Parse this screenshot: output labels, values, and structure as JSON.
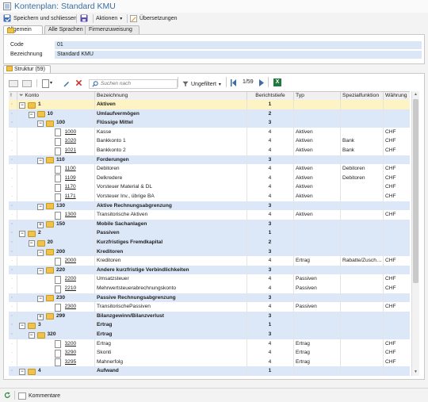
{
  "window": {
    "title": "Kontenplan: Standard KMU"
  },
  "toolbar": {
    "save_close_label": "Speichern und schliessen",
    "actions_label": "Aktionen",
    "translations_label": "Übersetzungen"
  },
  "tabs": [
    "Allgemein",
    "Alle Sprachen",
    "Firmenzuweisung"
  ],
  "fields": {
    "code_label": "Code",
    "code_value": "01",
    "name_label": "Bezeichnung",
    "name_value": "Standard KMU"
  },
  "structure_tab": "Struktur (59)",
  "gridbar": {
    "search_placeholder": "Suchen nach",
    "filter_label": "Ungefiltert",
    "page": "1/59"
  },
  "columns": [
    "!",
    "Konto",
    "Bezeichnung",
    "Berichtstiefe",
    "Typ",
    "Spezialfunktion",
    "Währung"
  ],
  "rows": [
    {
      "level": 0,
      "kind": "grp",
      "exp": "-",
      "konto": "1",
      "name": "Aktiven",
      "tiefe": "1",
      "typ": "",
      "spez": "",
      "cur": "",
      "sel": true
    },
    {
      "level": 1,
      "kind": "grp",
      "exp": "-",
      "konto": "10",
      "name": "Umlaufvermögen",
      "tiefe": "2",
      "typ": "",
      "spez": "",
      "cur": ""
    },
    {
      "level": 2,
      "kind": "grp",
      "exp": "-",
      "konto": "100",
      "name": "Flüssige Mittel",
      "tiefe": "3",
      "typ": "",
      "spez": "",
      "cur": ""
    },
    {
      "level": 3,
      "kind": "leaf",
      "konto": "1000",
      "name": "Kasse",
      "tiefe": "4",
      "typ": "Aktiven",
      "spez": "",
      "cur": "CHF"
    },
    {
      "level": 3,
      "kind": "leaf",
      "konto": "1020",
      "name": "Bankkonto 1",
      "tiefe": "4",
      "typ": "Aktiven",
      "spez": "Bank",
      "cur": "CHF"
    },
    {
      "level": 3,
      "kind": "leaf",
      "konto": "1021",
      "name": "Bankkonto 2",
      "tiefe": "4",
      "typ": "Aktiven",
      "spez": "Bank",
      "cur": "CHF"
    },
    {
      "level": 2,
      "kind": "grp",
      "exp": "-",
      "konto": "110",
      "name": "Forderungen",
      "tiefe": "3",
      "typ": "",
      "spez": "",
      "cur": ""
    },
    {
      "level": 3,
      "kind": "leaf",
      "konto": "1100",
      "name": "Debitoren",
      "tiefe": "4",
      "typ": "Aktiven",
      "spez": "Debitoren",
      "cur": "CHF"
    },
    {
      "level": 3,
      "kind": "leaf",
      "konto": "1109",
      "name": "Delkredere",
      "tiefe": "4",
      "typ": "Aktiven",
      "spez": "Debitoren",
      "cur": "CHF"
    },
    {
      "level": 3,
      "kind": "leaf",
      "konto": "1170",
      "name": "Vorsteuer Material & DL",
      "tiefe": "4",
      "typ": "Aktiven",
      "spez": "",
      "cur": "CHF"
    },
    {
      "level": 3,
      "kind": "leaf",
      "konto": "1171",
      "name": "Vorsteuer Inv., übrige BA",
      "tiefe": "4",
      "typ": "Aktiven",
      "spez": "",
      "cur": "CHF"
    },
    {
      "level": 2,
      "kind": "grp",
      "exp": "-",
      "konto": "130",
      "name": "Aktive Rechnungsabgrenzung",
      "tiefe": "3",
      "typ": "",
      "spez": "",
      "cur": ""
    },
    {
      "level": 3,
      "kind": "leaf",
      "konto": "1300",
      "name": "Transitorische Aktiven",
      "tiefe": "4",
      "typ": "Aktiven",
      "spez": "",
      "cur": "CHF"
    },
    {
      "level": 2,
      "kind": "grp",
      "exp": "+",
      "konto": "150",
      "name": "Mobile Sachanlagen",
      "tiefe": "3",
      "typ": "",
      "spez": "",
      "cur": ""
    },
    {
      "level": 0,
      "kind": "grp",
      "exp": "-",
      "konto": "2",
      "name": "Passiven",
      "tiefe": "1",
      "typ": "",
      "spez": "",
      "cur": ""
    },
    {
      "level": 1,
      "kind": "grp",
      "exp": "-",
      "konto": "20",
      "name": "Kurzfristiges Fremdkapital",
      "tiefe": "2",
      "typ": "",
      "spez": "",
      "cur": ""
    },
    {
      "level": 2,
      "kind": "grp",
      "exp": "-",
      "konto": "200",
      "name": "Kreditoren",
      "tiefe": "3",
      "typ": "",
      "spez": "",
      "cur": ""
    },
    {
      "level": 3,
      "kind": "leaf",
      "konto": "2000",
      "name": "Kreditoren",
      "tiefe": "4",
      "typ": "Ertrag",
      "spez": "Rabatte/Zusch…",
      "cur": "CHF"
    },
    {
      "level": 2,
      "kind": "grp",
      "exp": "-",
      "konto": "220",
      "name": "Andere kurzfristige Verbindlichkeiten",
      "tiefe": "3",
      "typ": "",
      "spez": "",
      "cur": ""
    },
    {
      "level": 3,
      "kind": "leaf",
      "konto": "2200",
      "name": "Umsatzsteuer",
      "tiefe": "4",
      "typ": "Passiven",
      "spez": "",
      "cur": "CHF"
    },
    {
      "level": 3,
      "kind": "leaf",
      "konto": "2210",
      "name": "Mehrwertsteuerabrechnungskonto",
      "tiefe": "4",
      "typ": "Passiven",
      "spez": "",
      "cur": "CHF"
    },
    {
      "level": 2,
      "kind": "grp",
      "exp": "-",
      "konto": "230",
      "name": "Passive Rechnungsabgrenzung",
      "tiefe": "3",
      "typ": "",
      "spez": "",
      "cur": ""
    },
    {
      "level": 3,
      "kind": "leaf",
      "konto": "2300",
      "name": "TransitorischePassiven",
      "tiefe": "4",
      "typ": "Passiven",
      "spez": "",
      "cur": "CHF"
    },
    {
      "level": 2,
      "kind": "grp",
      "exp": "+",
      "konto": "299",
      "name": "Bilanzgewinn/Bilanzverlust",
      "tiefe": "3",
      "typ": "",
      "spez": "",
      "cur": ""
    },
    {
      "level": 0,
      "kind": "grp",
      "exp": "-",
      "konto": "3",
      "name": "Ertrag",
      "tiefe": "1",
      "typ": "",
      "spez": "",
      "cur": ""
    },
    {
      "level": 1,
      "kind": "grp",
      "exp": "-",
      "konto": "320",
      "name": "Ertrag",
      "tiefe": "3",
      "typ": "",
      "spez": "",
      "cur": ""
    },
    {
      "level": 3,
      "kind": "leaf",
      "konto": "3200",
      "name": "Ertrag",
      "tiefe": "4",
      "typ": "Ertrag",
      "spez": "",
      "cur": "CHF"
    },
    {
      "level": 3,
      "kind": "leaf",
      "konto": "3290",
      "name": "Skonti",
      "tiefe": "4",
      "typ": "Ertrag",
      "spez": "",
      "cur": "CHF"
    },
    {
      "level": 3,
      "kind": "leaf",
      "konto": "3295",
      "name": "Mahnerfolg",
      "tiefe": "4",
      "typ": "Ertrag",
      "spez": "",
      "cur": "CHF"
    },
    {
      "level": 0,
      "kind": "grp",
      "exp": "-",
      "konto": "4",
      "name": "Aufwand",
      "tiefe": "1",
      "typ": "",
      "spez": "",
      "cur": ""
    }
  ],
  "status": {
    "comments_label": "Kommentare"
  },
  "colors": {
    "accent": "#3a6ea5",
    "group_row": "#dce7f7",
    "selected_row": "#fdf3c4",
    "folder": "#f0c24a"
  }
}
